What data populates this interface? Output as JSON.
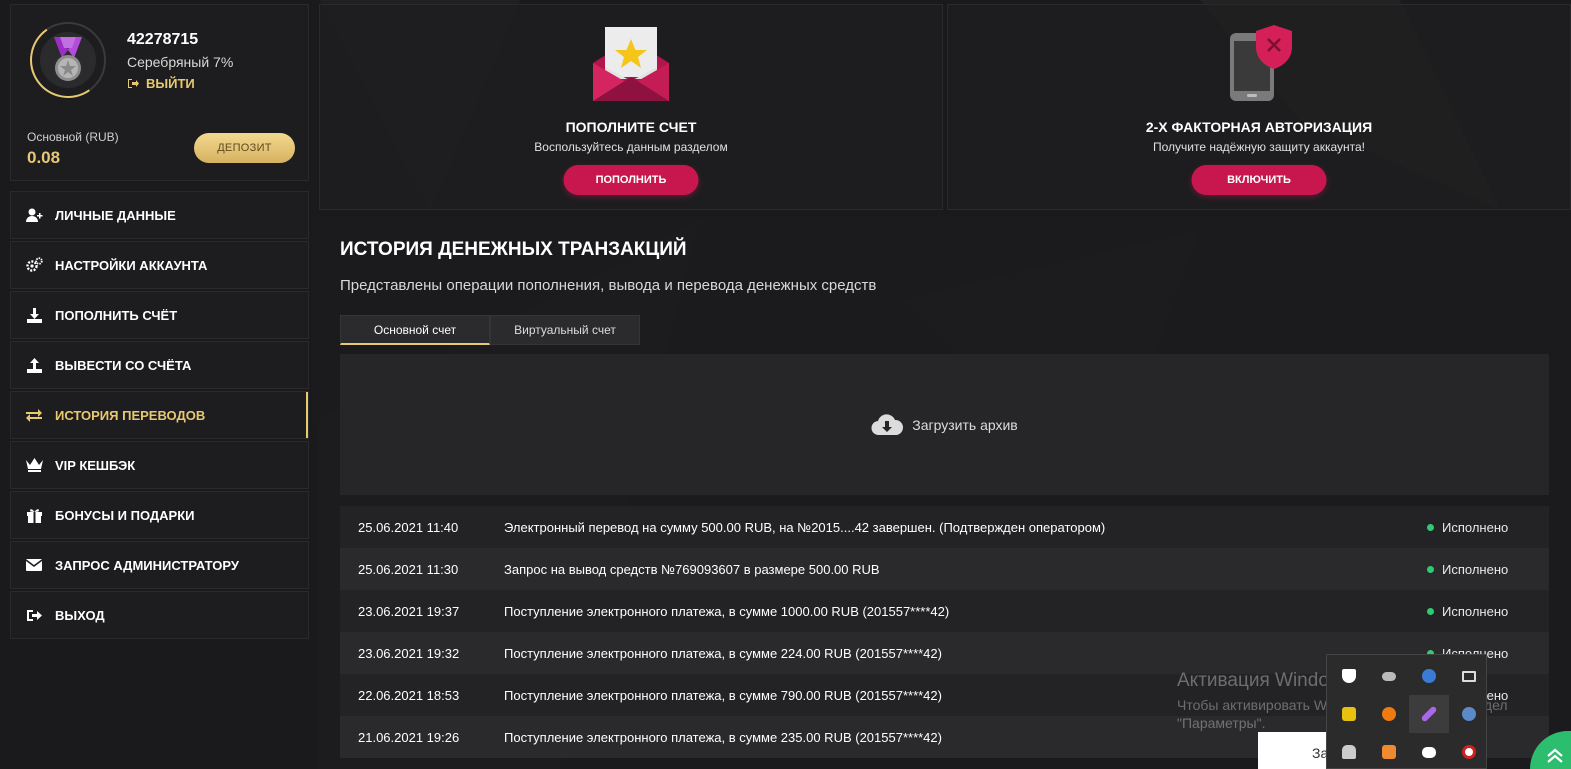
{
  "profile": {
    "user_id": "42278715",
    "level": "Серебряный 7%",
    "logout_label": "ВЫЙТИ",
    "balance_label": "Основной (RUB)",
    "balance_value": "0.08",
    "deposit_label": "ДЕПОЗИТ"
  },
  "menu": {
    "items": [
      {
        "label": "ЛИЧНЫЕ ДАННЫЕ",
        "icon": "user-plus-icon"
      },
      {
        "label": "НАСТРОЙКИ АККАУНТА",
        "icon": "gears-icon"
      },
      {
        "label": "ПОПОЛНИТЬ СЧЁТ",
        "icon": "download-icon"
      },
      {
        "label": "ВЫВЕСТИ СО СЧЁТА",
        "icon": "upload-icon"
      },
      {
        "label": "ИСТОРИЯ ПЕРЕВОДОВ",
        "icon": "transfer-arrows-icon",
        "active": true
      },
      {
        "label": "VIP КЕШБЭК",
        "icon": "crown-icon"
      },
      {
        "label": "БОНУСЫ И ПОДАРКИ",
        "icon": "gift-icon"
      },
      {
        "label": "ЗАПРОС АДМИНИСТРАТОРУ",
        "icon": "envelope-icon"
      },
      {
        "label": "ВЫХОД",
        "icon": "sign-out-icon"
      }
    ]
  },
  "cards": {
    "deposit": {
      "title": "ПОПОЛНИТЕ СЧЕТ",
      "subtitle": "Воспользуйтесь данным разделом",
      "button": "ПОПОЛНИТЬ",
      "icon": "envelope-star-icon"
    },
    "twofa": {
      "title": "2-Х ФАКТОРНАЯ АВТОРИЗАЦИЯ",
      "subtitle": "Получите надёжную защиту аккаунта!",
      "button": "ВКЛЮЧИТЬ",
      "icon": "phone-shield-icon"
    }
  },
  "history": {
    "title": "ИСТОРИЯ ДЕНЕЖНЫХ ТРАНЗАКЦИЙ",
    "subtitle": "Представлены операции пополнения, вывода и перевода денежных средств",
    "tabs": [
      "Основной счет",
      "Виртуальный счет"
    ],
    "archive_label": "Загрузить архив",
    "transactions": [
      {
        "date": "25.06.2021 11:40",
        "description": "Электронный перевод на сумму 500.00 RUB, на №2015....42 завершен. (Подтвержден оператором)",
        "status": "Исполнено"
      },
      {
        "date": "25.06.2021 11:30",
        "description": "Запрос на вывод средств №769093607 в размере 500.00 RUB",
        "status": "Исполнено"
      },
      {
        "date": "23.06.2021 19:37",
        "description": "Поступление электронного платежа, в сумме 1000.00 RUB (201557****42)",
        "status": "Исполнено"
      },
      {
        "date": "23.06.2021 19:32",
        "description": "Поступление электронного платежа, в сумме 224.00 RUB (201557****42)",
        "status": "Исполнено"
      },
      {
        "date": "22.06.2021 18:53",
        "description": "Поступление электронного платежа, в сумме 790.00 RUB (201557****42)",
        "status": "Исполнено"
      },
      {
        "date": "21.06.2021 19:26",
        "description": "Поступление электронного платежа, в сумме 235.00 RUB (201557****42)",
        "status": ""
      }
    ]
  },
  "windows_overlay": {
    "title": "Активация Windows",
    "text_line1": "Чтобы активировать Windows, перейдите в раздел",
    "text_line2": "\"Параметры\"."
  },
  "chat_widget": {
    "text": "За"
  },
  "colors": {
    "accent_gold": "#e8c870",
    "accent_pink": "#c8174f",
    "status_green": "#2ecc71",
    "background": "#1a1a1c"
  }
}
